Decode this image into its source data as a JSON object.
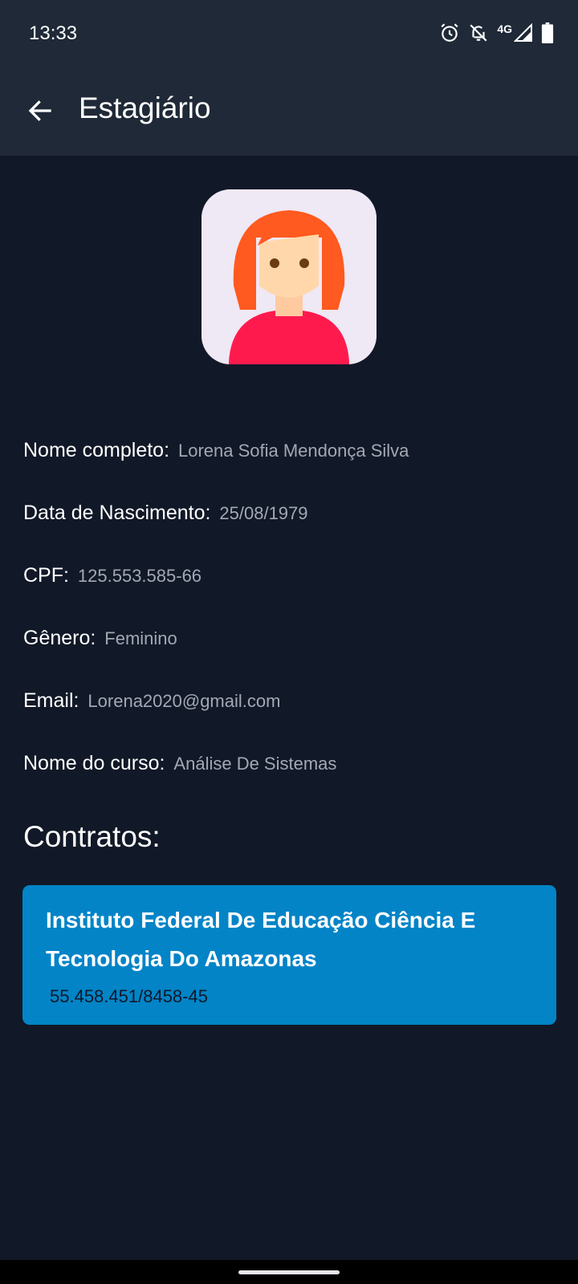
{
  "status_bar": {
    "time": "13:33",
    "network": "4G",
    "icons": [
      "alarm-icon",
      "notifications-off-icon",
      "signal-icon",
      "battery-icon"
    ]
  },
  "app_bar": {
    "title": "Estagiário",
    "back_icon": "arrow-left-icon"
  },
  "profile": {
    "avatar_icon": "female-avatar-icon",
    "fields": [
      {
        "label": "Nome completo:",
        "value": "Lorena Sofia Mendonça Silva"
      },
      {
        "label": "Data de Nascimento:",
        "value": "25/08/1979"
      },
      {
        "label": "CPF:",
        "value": "125.553.585-66"
      },
      {
        "label": "Gênero:",
        "value": "Feminino"
      },
      {
        "label": "Email:",
        "value": "Lorena2020@gmail.com"
      },
      {
        "label": "Nome do curso:",
        "value": "Análise De Sistemas"
      }
    ]
  },
  "contracts": {
    "title": "Contratos:",
    "items": [
      {
        "name": "Instituto Federal De Educação Ciência E Tecnologia Do Amazonas",
        "cnpj": "55.458.451/8458-45"
      }
    ]
  },
  "colors": {
    "background": "#111827",
    "app_bar": "#1f2937",
    "card": "#0284c7",
    "value_text": "#a3a8b3"
  }
}
